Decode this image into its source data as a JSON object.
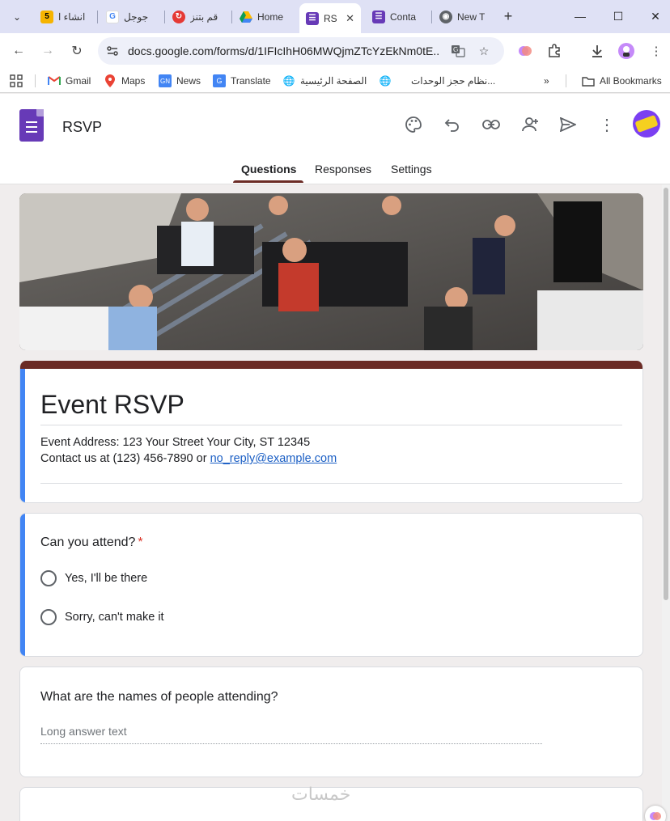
{
  "browser": {
    "tabs": [
      {
        "title": "انشاء ا",
        "favicon": "number-5-favicon",
        "fav_color": "#f6b400"
      },
      {
        "title": "جوجل",
        "favicon": "google-favicon",
        "fav_color": "#4285f4"
      },
      {
        "title": "قم بتنز",
        "favicon": "red-app-favicon",
        "fav_color": "#e53935"
      },
      {
        "title": "Home",
        "favicon": "google-drive-favicon",
        "fav_color": "#1fa463"
      },
      {
        "title": "RS",
        "favicon": "google-forms-favicon",
        "fav_color": "#673ab7",
        "active": true
      },
      {
        "title": "Conta",
        "favicon": "google-forms-favicon",
        "fav_color": "#673ab7"
      },
      {
        "title": "New T",
        "favicon": "chrome-favicon",
        "fav_color": "#5f6368"
      }
    ],
    "url": "docs.google.com/forms/d/1IFIcIhH06MWQjmZTcYzEkNm0tE...",
    "bookmarks": [
      {
        "label": "Gmail",
        "icon": "gmail-icon"
      },
      {
        "label": "Maps",
        "icon": "maps-pin-icon"
      },
      {
        "label": "News",
        "icon": "google-news-icon"
      },
      {
        "label": "Translate",
        "icon": "translate-icon"
      },
      {
        "label": "الصفحة الرئيسية",
        "icon": "globe-icon"
      },
      {
        "label": "نظام حجز الوحدات...",
        "icon": "globe-icon"
      }
    ],
    "all_bookmarks": "All Bookmarks"
  },
  "forms": {
    "doc_title": "RSVP",
    "tabs": [
      "Questions",
      "Responses",
      "Settings"
    ],
    "active_tab": "Questions",
    "theme_color": "#6b2b25",
    "accent_color": "#4285f4"
  },
  "form": {
    "title": "Event RSVP",
    "description_line1": "Event Address: 123 Your Street Your City, ST 12345",
    "description_line2_prefix": "Contact us at (123) 456-7890 or ",
    "email": "no_reply@example.com",
    "questions": [
      {
        "title": "Can you attend?",
        "required": true,
        "required_mark": "*",
        "type": "multiple-choice",
        "options": [
          "Yes,  I'll be there",
          "Sorry, can't make it"
        ]
      },
      {
        "title": "What are the names of people attending?",
        "type": "paragraph",
        "placeholder": "Long answer text"
      }
    ]
  },
  "watermark": "خمسات"
}
